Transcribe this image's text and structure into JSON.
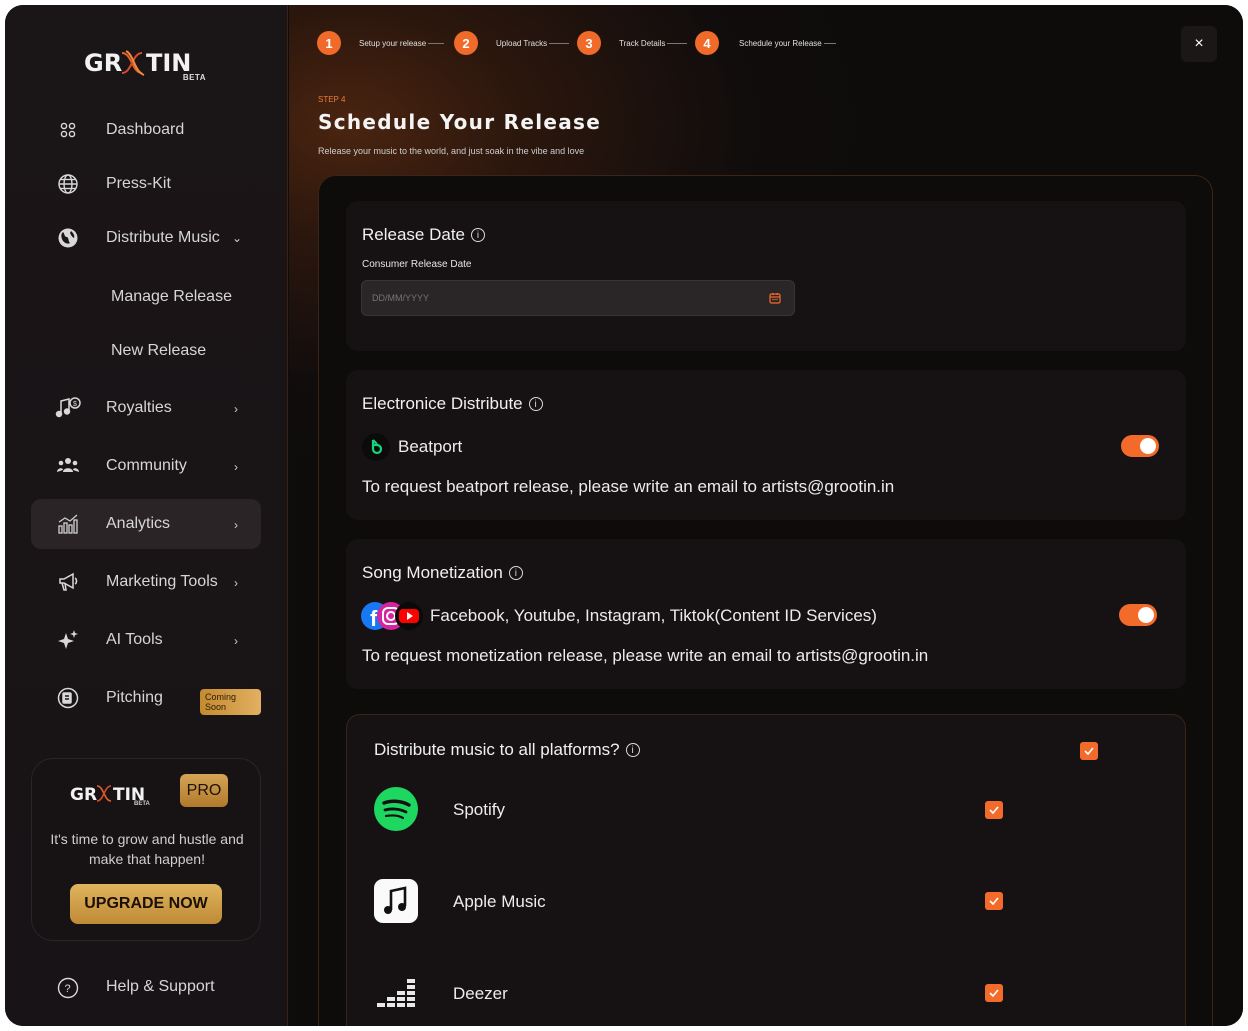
{
  "brand": {
    "name": "GROOTIN",
    "tag": "BETA"
  },
  "sidebar": {
    "items": [
      {
        "label": "Dashboard"
      },
      {
        "label": "Press-Kit"
      },
      {
        "label": "Distribute Music"
      },
      {
        "label": "Manage Release"
      },
      {
        "label": "New Release"
      },
      {
        "label": "Royalties"
      },
      {
        "label": "Community"
      },
      {
        "label": "Analytics"
      },
      {
        "label": "Marketing Tools"
      },
      {
        "label": "AI Tools"
      },
      {
        "label": "Pitching",
        "badge": "Coming Soon"
      }
    ],
    "promo": {
      "badge": "PRO",
      "text": "It's time to grow and hustle and make that happen!",
      "button": "UPGRADE NOW"
    },
    "help": "Help & Support"
  },
  "stepper": [
    {
      "num": "1",
      "label": "Setup your release"
    },
    {
      "num": "2",
      "label": "Upload Tracks"
    },
    {
      "num": "3",
      "label": "Track Details"
    },
    {
      "num": "4",
      "label": "Schedule your Release"
    }
  ],
  "close": "×",
  "header": {
    "step": "STEP 4",
    "title": "Schedule Your Release",
    "subtitle": "Release your music to the world, and just soak in the vibe and love"
  },
  "release": {
    "title": "Release Date",
    "field_label": "Consumer Release Date",
    "placeholder": "DD/MM/YYYY"
  },
  "electronic": {
    "title": "Electronice Distribute",
    "service": "Beatport",
    "note": "To request beatport release, please write an email to artists@grootin.in",
    "enabled": true
  },
  "monetization": {
    "title": "Song Monetization",
    "services": "Facebook, Youtube, Instagram, Tiktok(Content ID Services)",
    "note": "To request monetization release, please write an email to artists@grootin.in",
    "enabled": true
  },
  "platforms": {
    "title": "Distribute music to all platforms?",
    "all_checked": true,
    "list": [
      {
        "name": "Spotify",
        "checked": true
      },
      {
        "name": "Apple Music",
        "checked": true
      },
      {
        "name": "Deezer",
        "checked": true
      }
    ]
  },
  "colors": {
    "accent": "#f36b2b",
    "gold": "#d5a457",
    "bg": "#0f0c0c"
  }
}
